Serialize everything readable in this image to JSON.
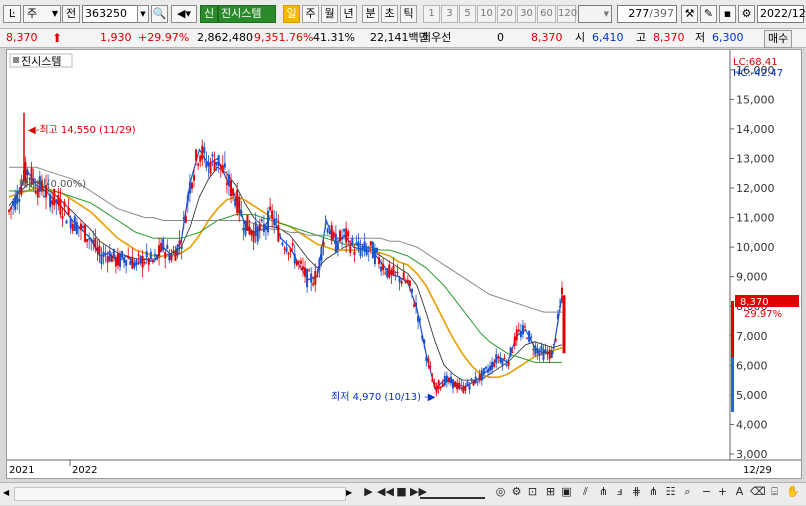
{
  "toolbar": {
    "market": "주",
    "market_btn": "전",
    "code": "363250",
    "stock_name_tag": "신",
    "stock_name": "진시스템",
    "periods": [
      "일",
      "주",
      "월",
      "년",
      "분",
      "초",
      "틱"
    ],
    "active_period": "일",
    "intervals": [
      "1",
      "3",
      "5",
      "10",
      "20",
      "30",
      "60",
      "120"
    ],
    "page_current": "277",
    "page_total": "/397",
    "date": "2022/12"
  },
  "info_bar": {
    "price": "8,370",
    "change": "1,930",
    "change_pct": "+29.97%",
    "volume": "2,862,480",
    "volume_ratio": "9,351.76%",
    "turnover": "41.31%",
    "amount": "22,141백만",
    "pref_label": "최우선",
    "pref_value": "0",
    "pref_price": "8,370",
    "open_label": "시",
    "open": "6,410",
    "high_label": "고",
    "high": "8,370",
    "low_label": "저",
    "low": "6,300",
    "buy_label": "매수"
  },
  "chart": {
    "legend_title": "진시스템",
    "high_annotation": "최고 14,550 (11/29)",
    "low_annotation": "최저 4,970 (10/13)",
    "exdiv_annotation": "배당락(0.00%)",
    "lc": "LC:68.41",
    "hc": "HC:-42.47",
    "price_tag": "8,370",
    "pct_tag": "29.97%",
    "yticks": [
      "16,000",
      "15,000",
      "14,000",
      "13,000",
      "12,000",
      "11,000",
      "10,000",
      "9,000",
      "8,000",
      "7,000",
      "6,000",
      "5,000",
      "4,000",
      "3,000"
    ],
    "xlabels": [
      "2021",
      "2022"
    ],
    "right_date": "12/29"
  },
  "chart_data": {
    "type": "line",
    "title": "진시스템",
    "ylim": [
      3000,
      16400
    ],
    "series": [
      {
        "values": [
          11200,
          11800,
          12600,
          12100,
          11900,
          11600,
          11300,
          10900,
          10600,
          10300,
          9700,
          9800,
          9500,
          9700,
          9400,
          9600,
          9500,
          10000,
          9700,
          10200,
          12200,
          13300,
          12800,
          13000,
          12300,
          11700,
          10800,
          10500,
          10600,
          11100,
          10300,
          10000,
          9400,
          8900,
          9000,
          10900,
          10100,
          10400,
          10000,
          9900,
          9900,
          9500,
          9100,
          9000,
          8800,
          7900,
          6400,
          5200,
          5500,
          5400,
          5200,
          5400,
          5600,
          5900,
          6300,
          6100,
          7000,
          7200,
          6600,
          6400,
          6400,
          8370
        ]
      },
      {
        "values": [
          11400,
          11800,
          12100,
          12200,
          12000,
          11800,
          11500,
          11200,
          10900,
          10600,
          10200,
          10000,
          9800,
          9700,
          9600,
          9600,
          9600,
          9700,
          9800,
          10000,
          10700,
          11700,
          12300,
          12700,
          12500,
          12100,
          11500,
          11000,
          10700,
          10700,
          10600,
          10400,
          10000,
          9600,
          9300,
          9600,
          9800,
          10000,
          10100,
          10100,
          9900,
          9700,
          9500,
          9300,
          9100,
          8700,
          7800,
          6800,
          6000,
          5700,
          5500,
          5500,
          5500,
          5700,
          5900,
          6100,
          6400,
          6700,
          6800,
          6700,
          6600,
          6700
        ]
      },
      {
        "values": [
          11700,
          11800,
          11900,
          12000,
          12000,
          11900,
          11800,
          11600,
          11400,
          11200,
          10900,
          10600,
          10300,
          10100,
          9900,
          9800,
          9700,
          9700,
          9700,
          9800,
          10000,
          10400,
          10900,
          11300,
          11600,
          11700,
          11600,
          11400,
          11200,
          11000,
          10800,
          10700,
          10500,
          10300,
          10100,
          10000,
          9900,
          9900,
          9900,
          9900,
          9900,
          9800,
          9700,
          9500,
          9400,
          9100,
          8700,
          8100,
          7500,
          6900,
          6400,
          6000,
          5700,
          5600,
          5600,
          5700,
          5900,
          6100,
          6300,
          6400,
          6500,
          6600
        ]
      },
      {
        "values": [
          11900,
          11900,
          11900,
          11900,
          11900,
          11900,
          11800,
          11700,
          11600,
          11500,
          11300,
          11100,
          10900,
          10700,
          10500,
          10400,
          10300,
          10300,
          10300,
          10300,
          10400,
          10500,
          10700,
          10900,
          11000,
          11100,
          11100,
          11100,
          11000,
          10900,
          10800,
          10700,
          10600,
          10500,
          10400,
          10300,
          10200,
          10100,
          10100,
          10000,
          10000,
          9900,
          9900,
          9800,
          9700,
          9500,
          9300,
          9000,
          8700,
          8300,
          7900,
          7500,
          7100,
          6800,
          6600,
          6400,
          6300,
          6200,
          6100,
          6100,
          6100,
          6100
        ]
      },
      {
        "values": [
          12700,
          12700,
          12700,
          12700,
          12600,
          12500,
          12400,
          12300,
          12100,
          11900,
          11700,
          11500,
          11300,
          11200,
          11100,
          11000,
          11000,
          10900,
          10900,
          10900,
          10900,
          10900,
          10900,
          10900,
          10900,
          10900,
          10900,
          10800,
          10700,
          10600,
          10600,
          10500,
          10500,
          10400,
          10400,
          10400,
          10300,
          10300,
          10300,
          10300,
          10300,
          10300,
          10200,
          10200,
          10100,
          10000,
          9800,
          9600,
          9400,
          9200,
          9000,
          8800,
          8600,
          8400,
          8300,
          8200,
          8100,
          8000,
          7900,
          7800,
          7800,
          7800
        ]
      }
    ]
  }
}
